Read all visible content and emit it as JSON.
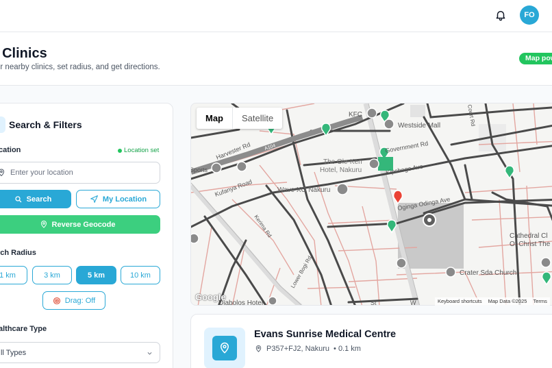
{
  "topbar": {
    "avatar_initials": "FO",
    "icons": [
      "bell-icon"
    ]
  },
  "header": {
    "title": "l Clinics",
    "subtitle": "er nearby clinics, set radius, and get directions.",
    "map_pill": "Map pow"
  },
  "filters": {
    "title": "Search & Filters",
    "location_label": "cation",
    "location_status": "Location set",
    "location_placeholder": "Enter your location",
    "search_label": "Search",
    "my_location_label": "My Location",
    "reverse_geocode_label": "Reverse Geocode",
    "radius_label": "rch Radius",
    "radius_options": [
      "1 km",
      "3 km",
      "5 km",
      "10 km"
    ],
    "radius_selected": "5 km",
    "drag_label": "Drag: Off",
    "healthcare_label": "althcare Type",
    "healthcare_value": "ll Types"
  },
  "map": {
    "type_options": [
      "Map",
      "Satellite"
    ],
    "type_selected": "Map",
    "labels": {
      "kfc": "KFC",
      "westside_mall": "Westside Mall",
      "harvester_rd": "Harvester Rd",
      "government_rd": "Government Rd",
      "the_ole_ken_1": "The Ole-Ken",
      "the_ole_ken_2": "Hotel, Nakuru",
      "kipchoge_ave": "Kipchoge Ave",
      "kufanya_road": "Kufanya Road",
      "wave_xo": "Wave XO Nakuru",
      "oginga_odinga_ave": "Oginga Odinga Ave",
      "kerima_rd": "Kerima Rd",
      "lower_rd": "Lower Bogi Rd",
      "cathedral_1": "Cathedral Cl",
      "cathedral_2": "Of Christ The",
      "crater_sda": "Crater Sda Church",
      "diabolos": "Diabolos Hotel",
      "sports": "Sports",
      "a104": "A104",
      "st": "St",
      "w": "W",
      "court_rd": "Court Rd"
    },
    "google": "Google",
    "attribution": [
      "Keyboard shortcuts",
      "Map Data ©2025",
      "Terms"
    ]
  },
  "result": {
    "name": "Evans Sunrise Medical Centre",
    "address": "P357+FJ2, Nakuru",
    "distance": "• 0.1 km"
  },
  "colors": {
    "accent": "#29a8d6",
    "success": "#3ccf7f",
    "marker_red": "#ea4335"
  }
}
